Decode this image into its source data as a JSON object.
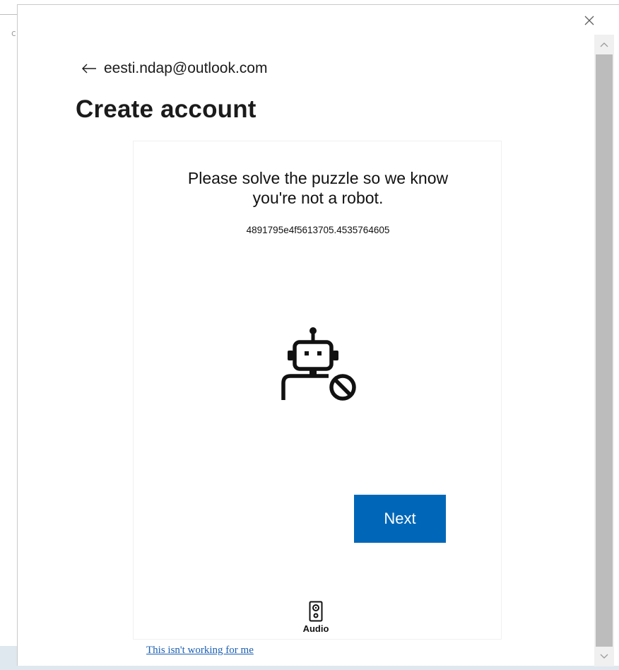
{
  "background": {
    "fragment": "c"
  },
  "dialog": {
    "close_label": "×"
  },
  "account": {
    "email": "eesti.ndap@outlook.com",
    "title": "Create account"
  },
  "puzzle": {
    "prompt_line1": "Please solve the puzzle so we know",
    "prompt_line2": "you're not a robot.",
    "session_id": "4891795e4f5613705.4535764605",
    "icon": "robot-prohibited-icon",
    "next_label": "Next",
    "audio_label": "Audio",
    "audio_icon": "speaker-icon",
    "not_working_link": "This isn't working for me"
  },
  "colors": {
    "primary_button": "#0067b8",
    "link": "#1a5fb4",
    "scroll_thumb": "#bcbcbc"
  }
}
